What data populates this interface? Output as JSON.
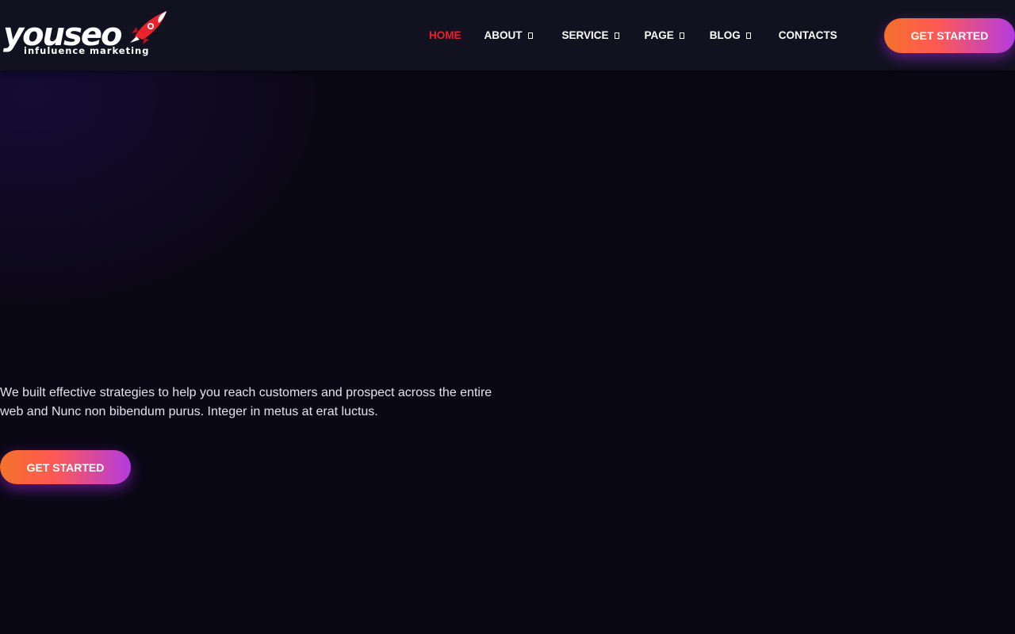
{
  "brand": {
    "name": "youseo",
    "tagline": "infuluence marketing",
    "accent_color": "#e8232e",
    "icon": "rocket-icon"
  },
  "nav": {
    "items": [
      {
        "label": "HOME",
        "active": true,
        "has_dropdown": false
      },
      {
        "label": "ABOUT",
        "active": false,
        "has_dropdown": true
      },
      {
        "label": "SERVICE",
        "active": false,
        "has_dropdown": true
      },
      {
        "label": "PAGE",
        "active": false,
        "has_dropdown": true
      },
      {
        "label": "BLOG",
        "active": false,
        "has_dropdown": true
      },
      {
        "label": "CONTACTS",
        "active": false,
        "has_dropdown": false
      }
    ],
    "cta_label": "GET STARTED"
  },
  "hero": {
    "description": "We built effective strategies to help you reach customers and prospect across the entire web and Nunc non bibendum purus. Integer in metus at erat luctus.",
    "cta_label": "GET STARTED"
  },
  "colors": {
    "background": "#0b0816",
    "header_background": "#11111f",
    "button_gradient_start": "#f3712b",
    "button_gradient_end": "#b43be0"
  }
}
